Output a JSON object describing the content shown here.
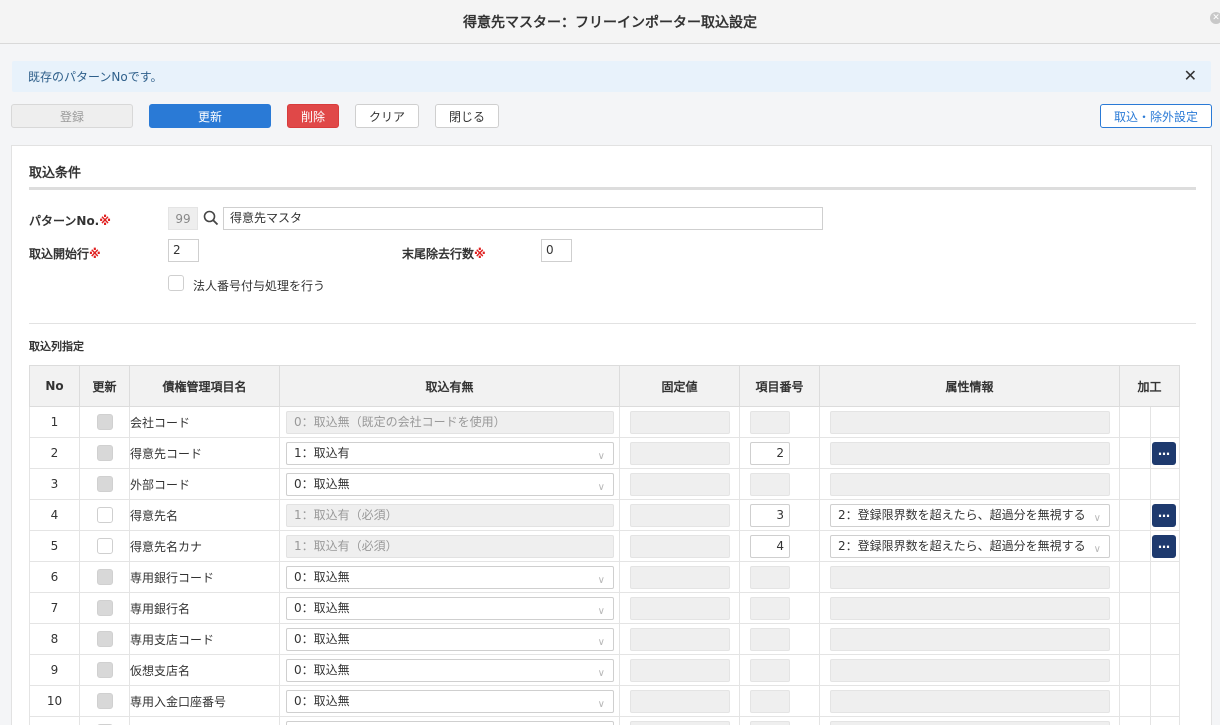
{
  "window": {
    "title": "得意先マスター：フリーインポーター取込設定"
  },
  "notice": {
    "message": "既存のパターンNoです。",
    "close": "✕"
  },
  "toolbar": {
    "register": "登録",
    "update": "更新",
    "delete": "削除",
    "clear": "クリア",
    "close": "閉じる",
    "import_settings": "取込・除外設定"
  },
  "conditions": {
    "title": "取込条件",
    "pattern_label": "パターンNo.",
    "required_mark": "※",
    "pattern_no": "99",
    "pattern_name": "得意先マスタ",
    "start_row_label": "取込開始行",
    "start_row": "2",
    "trailing_label": "末尾除去行数",
    "trailing": "0",
    "corp_number_label": "法人番号付与処理を行う"
  },
  "columns_section": {
    "title": "取込列指定"
  },
  "table": {
    "headers": [
      "No",
      "更新",
      "債権管理項目名",
      "取込有無",
      "固定値",
      "項目番号",
      "属性情報",
      "加工"
    ],
    "rows": [
      {
        "no": "1",
        "update": "disabled",
        "name": "会社コード",
        "import": "0：取込無（既定の会社コードを使用）",
        "import_disabled": true,
        "item_no": "",
        "item_no_enabled": false,
        "attr": "",
        "attr_enabled": false,
        "proc": false
      },
      {
        "no": "2",
        "update": "disabled",
        "name": "得意先コード",
        "import": "1：取込有",
        "import_disabled": false,
        "item_no": "2",
        "item_no_enabled": true,
        "attr": "",
        "attr_enabled": false,
        "proc": true
      },
      {
        "no": "3",
        "update": "disabled",
        "name": "外部コード",
        "import": "0：取込無",
        "import_disabled": false,
        "item_no": "",
        "item_no_enabled": false,
        "attr": "",
        "attr_enabled": false,
        "proc": false
      },
      {
        "no": "4",
        "update": "enabled",
        "name": "得意先名",
        "import": "1：取込有（必須）",
        "import_disabled": true,
        "item_no": "3",
        "item_no_enabled": true,
        "attr": "2：登録限界数を超えたら、超過分を無視する",
        "attr_enabled": true,
        "proc": true
      },
      {
        "no": "5",
        "update": "enabled",
        "name": "得意先名カナ",
        "import": "1：取込有（必須）",
        "import_disabled": true,
        "item_no": "4",
        "item_no_enabled": true,
        "attr": "2：登録限界数を超えたら、超過分を無視する",
        "attr_enabled": true,
        "proc": true
      },
      {
        "no": "6",
        "update": "disabled",
        "name": "専用銀行コード",
        "import": "0：取込無",
        "import_disabled": false,
        "item_no": "",
        "item_no_enabled": false,
        "attr": "",
        "attr_enabled": false,
        "proc": false
      },
      {
        "no": "7",
        "update": "disabled",
        "name": "専用銀行名",
        "import": "0：取込無",
        "import_disabled": false,
        "item_no": "",
        "item_no_enabled": false,
        "attr": "",
        "attr_enabled": false,
        "proc": false
      },
      {
        "no": "8",
        "update": "disabled",
        "name": "専用支店コード",
        "import": "0：取込無",
        "import_disabled": false,
        "item_no": "",
        "item_no_enabled": false,
        "attr": "",
        "attr_enabled": false,
        "proc": false
      },
      {
        "no": "9",
        "update": "disabled",
        "name": "仮想支店名",
        "import": "0：取込無",
        "import_disabled": false,
        "item_no": "",
        "item_no_enabled": false,
        "attr": "",
        "attr_enabled": false,
        "proc": false
      },
      {
        "no": "10",
        "update": "disabled",
        "name": "専用入金口座番号",
        "import": "0：取込無",
        "import_disabled": false,
        "item_no": "",
        "item_no_enabled": false,
        "attr": "",
        "attr_enabled": false,
        "proc": false
      },
      {
        "no": "",
        "update": "disabled",
        "name": "",
        "import": "",
        "import_disabled": false,
        "item_no": "",
        "item_no_enabled": false,
        "attr": "",
        "attr_enabled": false,
        "proc": false
      }
    ],
    "more_label": "…"
  },
  "colors": {
    "primary": "#2a7ad6",
    "danger": "#e04848",
    "navy": "#1e3a6e",
    "required": "#e02020"
  },
  "icons": {
    "search": "search-icon",
    "close": "close-icon",
    "chevron": "chevron-down-icon",
    "more": "ellipsis-icon"
  }
}
